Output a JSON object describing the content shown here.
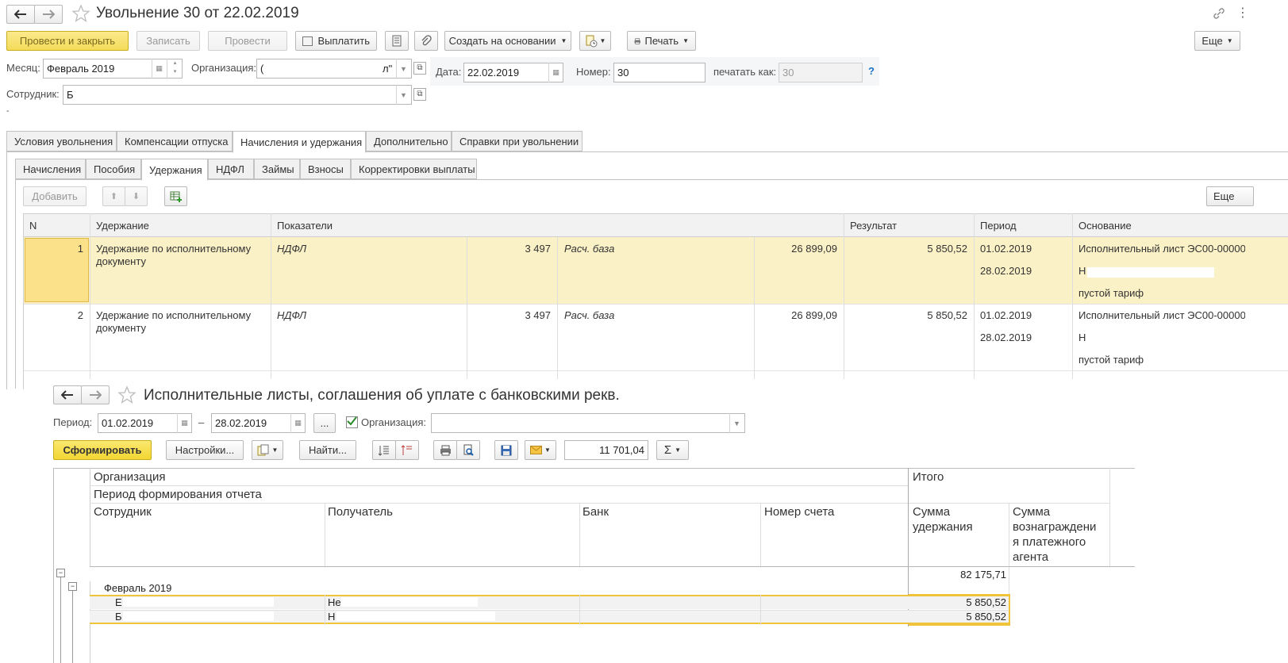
{
  "top": {
    "title": "Увольнение 30 от 22.02.2019",
    "buttons": {
      "post_close": "Провести и закрыть",
      "save": "Записать",
      "post": "Провести",
      "pay": "Выплатить",
      "create_basis": "Создать на основании",
      "print": "Печать",
      "more": "Еще"
    },
    "fields": {
      "month_label": "Месяц:",
      "month_value": "Февраль 2019",
      "org_label": "Организация:",
      "org_value_start": "(",
      "org_value_end": "л\"",
      "date_label": "Дата:",
      "date_value": "22.02.2019",
      "number_label": "Номер:",
      "number_value": "30",
      "print_as_label": "печатать как:",
      "print_as_value": "30",
      "help": "?",
      "employee_label": "Сотрудник:",
      "employee_value": "Б",
      "dash": "-"
    },
    "tabs": [
      "Условия увольнения",
      "Компенсации отпуска",
      "Начисления и удержания",
      "Дополнительно",
      "Справки при увольнении"
    ],
    "subtabs": [
      "Начисления",
      "Пособия",
      "Удержания",
      "НДФЛ",
      "Займы",
      "Взносы",
      "Корректировки выплаты"
    ],
    "grid_buttons": {
      "add": "Добавить",
      "more": "Еще"
    },
    "table": {
      "headers": [
        "N",
        "Удержание",
        "Показатели",
        "Результат",
        "Период",
        "Основание"
      ],
      "rows": [
        {
          "n": "1",
          "deduction_line1": "Удержание по исполнительному",
          "deduction_line2": "документу",
          "indicator1": "НДФЛ",
          "value1": "3 497",
          "indicator2": "Расч. база",
          "value2": "26 899,09",
          "result": "5 850,52",
          "period_from": "01.02.2019",
          "period_to": "28.02.2019",
          "basis1": "Исполнительный лист ЭС00-00000...",
          "basis2": "Н",
          "basis3": "пустой тариф"
        },
        {
          "n": "2",
          "deduction_line1": "Удержание по исполнительному",
          "deduction_line2": "документу",
          "indicator1": "НДФЛ",
          "value1": "3 497",
          "indicator2": "Расч. база",
          "value2": "26 899,09",
          "result": "5 850,52",
          "period_from": "01.02.2019",
          "period_to": "28.02.2019",
          "basis1": "Исполнительный лист ЭС00-00000...",
          "basis2": "Н",
          "basis3": "пустой тариф"
        }
      ]
    }
  },
  "report": {
    "title": "Исполнительные листы, соглашения об уплате с банковскими рекв.",
    "period_label": "Период:",
    "period_from": "01.02.2019",
    "period_dash": "–",
    "period_to": "28.02.2019",
    "dots": "...",
    "org_label": "Организация:",
    "buttons": {
      "generate": "Сформировать",
      "settings": "Настройки...",
      "find": "Найти...",
      "sum_value": "11 701,04",
      "sigma": "Σ"
    },
    "headers": {
      "org": "Организация",
      "period": "Период формирования отчета",
      "employee": "Сотрудник",
      "recipient": "Получатель",
      "bank": "Банк",
      "account": "Номер счета",
      "total": "Итого",
      "deduction_sum_1": "Сумма",
      "deduction_sum_2": "удержания",
      "agent_1": "Сумма",
      "agent_2": "вознаграждени",
      "agent_3": "я платежного",
      "agent_4": "агента"
    },
    "grand_total": "82 175,71",
    "group_label": "Февраль 2019",
    "rows": [
      {
        "employee": "Е",
        "recipient": "Не",
        "sum": "5 850,52"
      },
      {
        "employee": "Б",
        "recipient": "Н",
        "sum": "5 850,52"
      }
    ]
  }
}
